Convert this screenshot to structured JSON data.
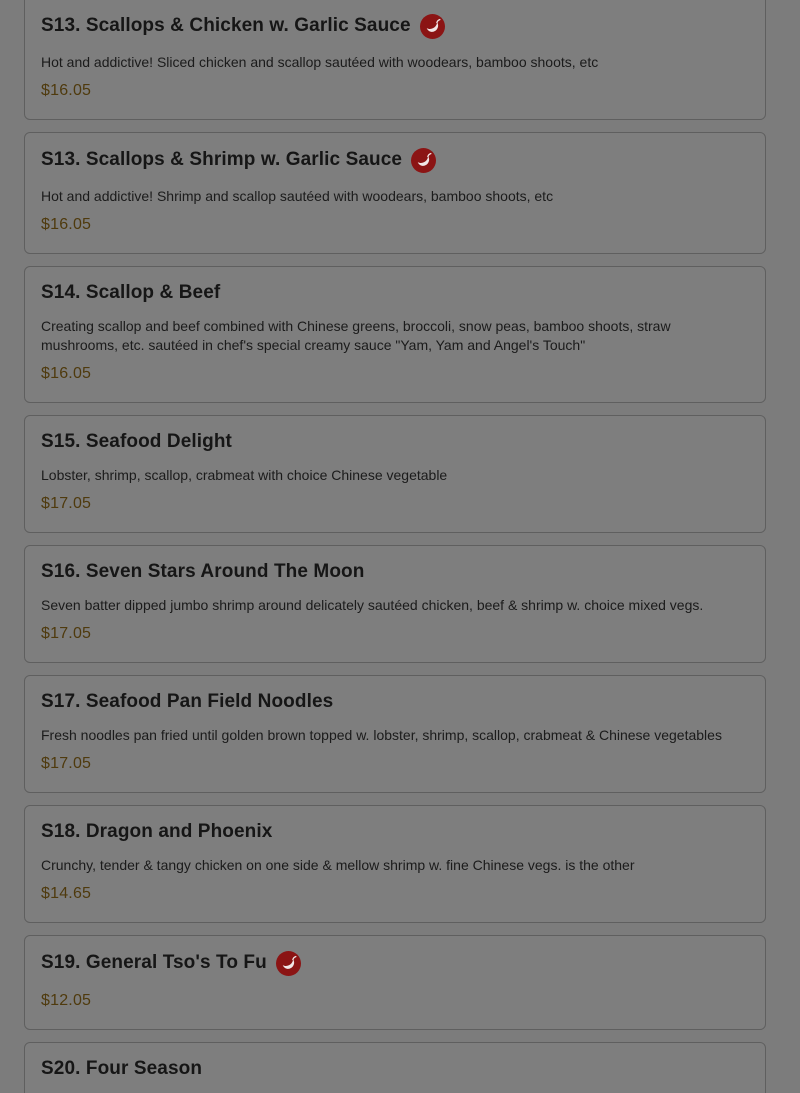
{
  "colors": {
    "overlay_background": "#7c7c7c",
    "card_background": "#7e7e7e",
    "title_text": "#161616",
    "price_text": "#4f3a0d",
    "spicy_badge": "#8b1414"
  },
  "menu": {
    "items": [
      {
        "title": "S13. Scallops & Chicken w. Garlic Sauce",
        "spicy": true,
        "spicy_icon": "chili-pepper-icon",
        "description": "Hot and addictive! Sliced chicken and scallop sautéed with woodears, bamboo shoots, etc",
        "price": "$16.05"
      },
      {
        "title": "S13. Scallops & Shrimp w. Garlic Sauce",
        "spicy": true,
        "spicy_icon": "chili-pepper-icon",
        "description": "Hot and addictive! Shrimp and scallop sautéed with woodears, bamboo shoots, etc",
        "price": "$16.05"
      },
      {
        "title": "S14. Scallop & Beef",
        "spicy": false,
        "description": "Creating scallop and beef combined with Chinese greens, broccoli, snow peas, bamboo shoots, straw mushrooms, etc. sautéed in chef's special creamy sauce \"Yam, Yam and Angel's Touch\"",
        "price": "$16.05"
      },
      {
        "title": "S15. Seafood Delight",
        "spicy": false,
        "description": "Lobster, shrimp, scallop, crabmeat with choice Chinese vegetable",
        "price": "$17.05"
      },
      {
        "title": "S16. Seven Stars Around The Moon",
        "spicy": false,
        "description": "Seven batter dipped jumbo shrimp around delicately sautéed chicken, beef & shrimp w. choice mixed vegs.",
        "price": "$17.05"
      },
      {
        "title": "S17. Seafood Pan Field Noodles",
        "spicy": false,
        "description": "Fresh noodles pan fried until golden brown topped w. lobster, shrimp, scallop, crabmeat & Chinese vegetables",
        "price": "$17.05"
      },
      {
        "title": "S18. Dragon and Phoenix",
        "spicy": false,
        "description": "Crunchy, tender & tangy chicken on one side & mellow shrimp w. fine Chinese vegs. is the other",
        "price": "$14.65"
      },
      {
        "title": "S19. General Tso's To Fu",
        "spicy": true,
        "spicy_icon": "chili-pepper-icon",
        "description": "",
        "price": "$12.05"
      },
      {
        "title": "S20. Four Season",
        "spicy": false,
        "description": "",
        "price": ""
      }
    ]
  }
}
